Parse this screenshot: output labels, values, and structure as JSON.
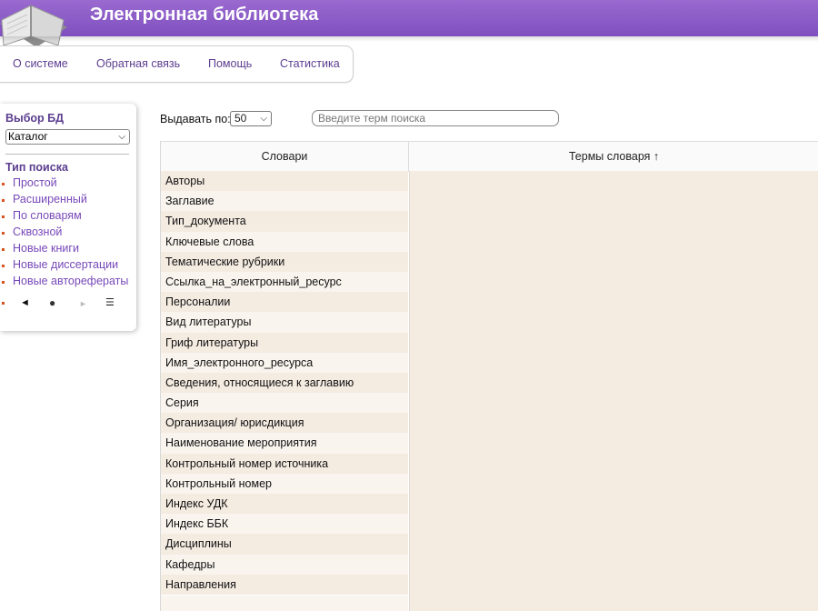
{
  "header": {
    "title": "Электронная библиотека"
  },
  "nav": [
    {
      "label": "О системе"
    },
    {
      "label": "Обратная связь"
    },
    {
      "label": "Помощь"
    },
    {
      "label": "Статистика"
    }
  ],
  "sidebar": {
    "db_heading": "Выбор БД",
    "db_selected": "Каталог",
    "search_type_heading": "Тип поиска",
    "items": [
      {
        "label": "Простой"
      },
      {
        "label": "Расширенный"
      },
      {
        "label": "По словарям"
      },
      {
        "label": "Сквозной"
      },
      {
        "label": "Новые книги"
      },
      {
        "label": "Новые диссертации"
      },
      {
        "label": "Новые авторефераты"
      }
    ],
    "controls": {
      "prev": "◄",
      "dot": "●",
      "next": "►",
      "menu": "☰"
    }
  },
  "toolbar": {
    "per_page_label": "Выдавать по:",
    "per_page_value": "50",
    "search_placeholder": "Введите терм поиска"
  },
  "table": {
    "col_dictionaries": "Словари",
    "col_terms": "Термы словаря ↑",
    "dictionaries": [
      "Авторы",
      "Заглавие",
      "Тип_документа",
      "Ключевые слова",
      "Тематические рубрики",
      "Ссылка_на_электронный_ресурс",
      "Персоналии",
      "Вид литературы",
      "Гриф литературы",
      "Имя_электронного_ресурса",
      "Сведения, относящиеся к заглавию",
      "Серия",
      "Организация/ юрисдикция",
      "Наименование мероприятия",
      "Контрольный номер источника",
      "Контрольный номер",
      "Индекс УДК",
      "Индекс ББК",
      "Дисциплины",
      "Кафедры",
      "Направления"
    ]
  },
  "colors": {
    "header": "#8a5ac7",
    "link": "#7748b8",
    "row_bg": "#f4ebe1",
    "bullet": "#d9531e"
  }
}
